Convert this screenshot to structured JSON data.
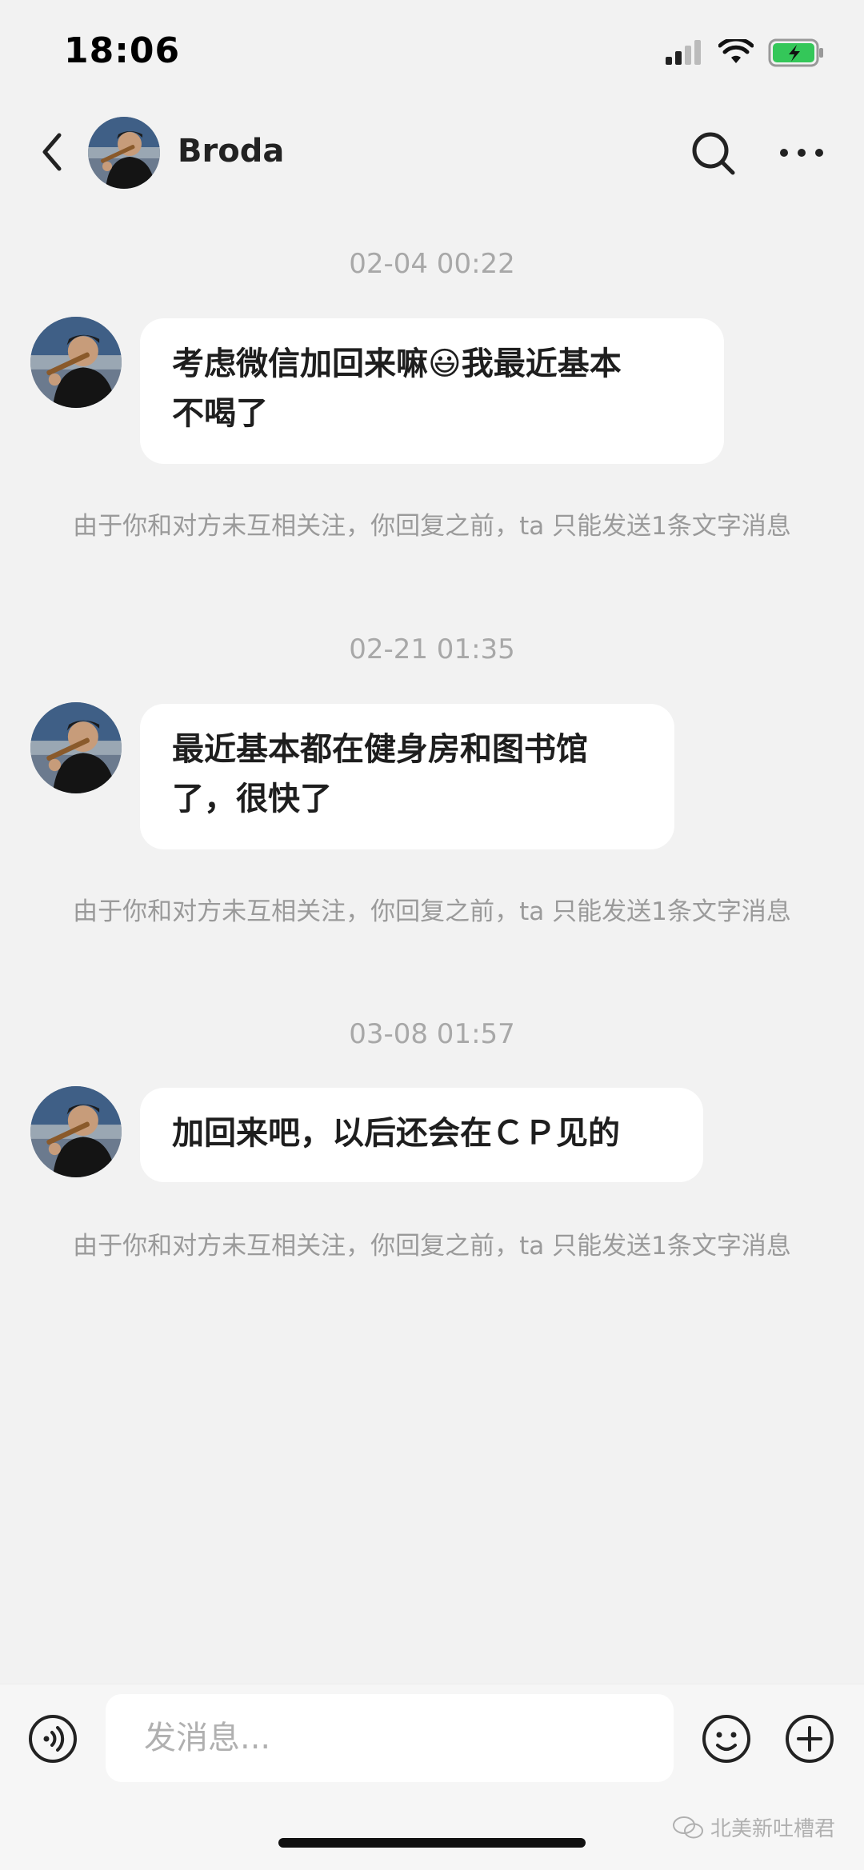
{
  "status_bar": {
    "time": "18:06"
  },
  "header": {
    "contact_name": "Broda"
  },
  "messages": [
    {
      "timestamp": "02-04 00:22",
      "text_before_emoji": "考虑微信加回来嘛",
      "emoji": "😃",
      "text_after_emoji": "我最近基本",
      "text_line2": "不喝了",
      "note": "由于你和对方未互相关注，你回复之前，ta 只能发送1条文字消息"
    },
    {
      "timestamp": "02-21 01:35",
      "text_line1": "最近基本都在健身房和图书馆",
      "text_line2": "了，很快了",
      "note": "由于你和对方未互相关注，你回复之前，ta 只能发送1条文字消息"
    },
    {
      "timestamp": "03-08 01:57",
      "text_line1": "加回来吧，以后还会在ＣＰ见的",
      "note": "由于你和对方未互相关注，你回复之前，ta 只能发送1条文字消息"
    }
  ],
  "input": {
    "placeholder": "发消息..."
  },
  "watermark": "北美新吐槽君",
  "colors": {
    "background": "#f2f2f2",
    "bubble": "#ffffff",
    "battery_fill": "#34c759"
  },
  "icons": [
    "back-icon",
    "search-icon",
    "more-icon",
    "voice-icon",
    "emoji-icon",
    "plus-icon",
    "wechat-icon"
  ]
}
